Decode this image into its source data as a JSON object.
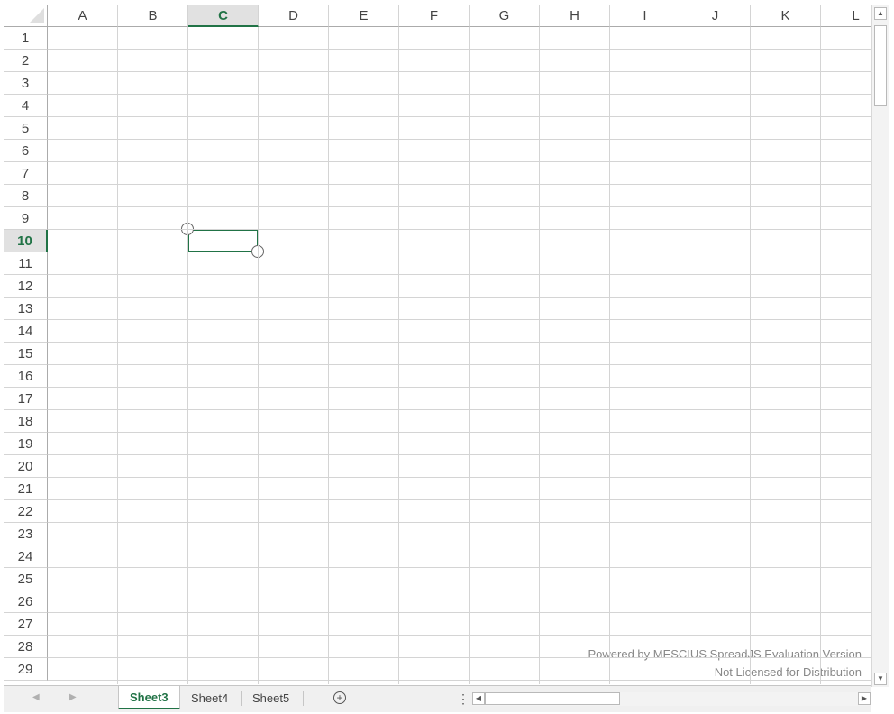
{
  "sheet": {
    "columns": [
      "A",
      "B",
      "C",
      "D",
      "E",
      "F",
      "G",
      "H",
      "I",
      "J",
      "K",
      "L"
    ],
    "rows": [
      "1",
      "2",
      "3",
      "4",
      "5",
      "6",
      "7",
      "8",
      "9",
      "10",
      "11",
      "12",
      "13",
      "14",
      "15",
      "16",
      "17",
      "18",
      "19",
      "20",
      "21",
      "22",
      "23",
      "24",
      "25",
      "26",
      "27",
      "28",
      "29"
    ],
    "selected_column": "C",
    "selected_row": "10",
    "active_cell": "C10"
  },
  "watermark": {
    "line1": "Powered by MESCIUS SpreadJS Evaluation Version",
    "line2": "Not Licensed for Distribution"
  },
  "tabs": [
    {
      "label": "Sheet3",
      "active": true
    },
    {
      "label": "Sheet4",
      "active": false
    },
    {
      "label": "Sheet5",
      "active": false
    }
  ],
  "icons": {
    "nav_prev": "chevron-left-icon",
    "nav_next": "chevron-right-icon",
    "add_sheet": "plus-circle-icon",
    "splitter": "vertical-dots-icon",
    "scroll_up": "triangle-up-icon",
    "scroll_down": "triangle-down-icon",
    "scroll_left": "triangle-left-icon",
    "scroll_right": "triangle-right-icon"
  },
  "colors": {
    "accent": "#217346",
    "gridline": "#d4d4d4",
    "header_selected_bg": "#e1e1e1"
  }
}
